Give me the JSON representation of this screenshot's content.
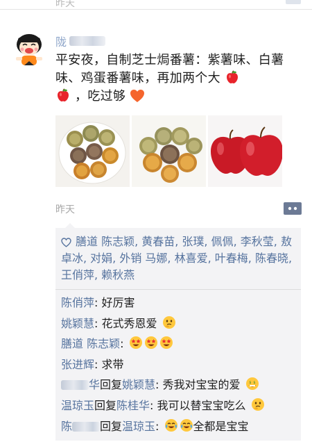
{
  "prev_post": {
    "faded_text": "昨天"
  },
  "post": {
    "author_visible": "陇",
    "text_part1": "平安夜，自制芝士焗番薯：紫薯味、白薯味、鸡蛋番薯味，再加两个大",
    "text_part2": "，吃过够",
    "photos": [
      "cheese-sweet-potato-tarts-plate",
      "cheese-sweet-potato-tarts-closeup",
      "two-red-apples"
    ],
    "time": "昨天",
    "likes_label": "膳道 陈志颖, 黄春苗, 张璞, 佩佩, 李秋莹, 敖卓冰, 对娟, 外销 马娜, 林喜爱, 叶春梅, 陈春晓, 王俏萍, 赖秋燕"
  },
  "comments": [
    {
      "name": "陈俏萍",
      "text": ": 好厉害",
      "emojis": []
    },
    {
      "name": "姚颖慧",
      "text": ": 花式秀恩爱",
      "emojis": [
        "thinking-face"
      ]
    },
    {
      "name": "膳道 陈志颖",
      "text": ": ",
      "emojis": [
        "star-eyes",
        "star-eyes",
        "star-eyes"
      ]
    },
    {
      "name": "张进辉",
      "text": ": 求带",
      "emojis": []
    },
    {
      "name_visible": "华",
      "reply_word": "回复",
      "reply_to": "姚颖慧",
      "text": ": 秀我对宝宝的爱",
      "emojis": [
        "money-mouth"
      ]
    },
    {
      "name": "温琼玉",
      "reply_word": "回复",
      "reply_to": "陈桂华",
      "text": ": 我可以替宝宝吃么",
      "emojis": [
        "thinking-face"
      ]
    },
    {
      "name_visible": "陈",
      "reply_word": "回复",
      "reply_to": "温琼玉",
      "text": ": ",
      "text_after": "全都是宝宝",
      "emojis": [
        "tears-of-joy",
        "tears-of-joy"
      ]
    }
  ],
  "colors": {
    "name_blue": "#56739e",
    "feedback_bg": "#f3f3f5",
    "time_gray": "#a8a8a8"
  }
}
